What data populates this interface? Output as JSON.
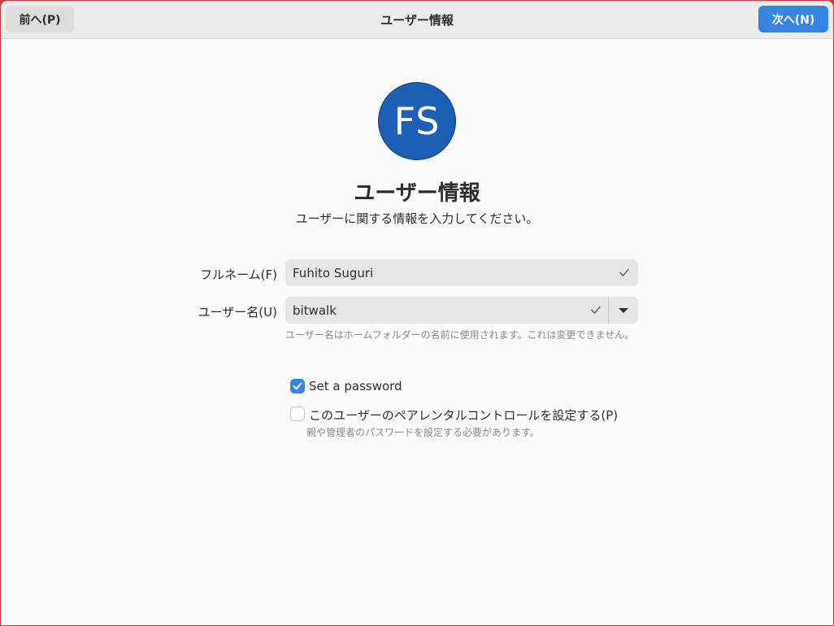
{
  "header": {
    "back_label": "前へ(P)",
    "title": "ユーザー情報",
    "next_label": "次へ(N)"
  },
  "avatar": {
    "initials": "FS",
    "color": "#1c5fb5"
  },
  "page": {
    "title": "ユーザー情報",
    "subtitle": "ユーザーに関する情報を入力してください。"
  },
  "form": {
    "fullname_label": "フルネーム(F)",
    "fullname_value": "Fuhito Suguri",
    "username_label": "ユーザー名(U)",
    "username_value": "bitwalk",
    "username_hint": "ユーザー名はホームフォルダーの名前に使用されます。これは変更できません。"
  },
  "options": {
    "set_password_label": "Set a password",
    "set_password_checked": true,
    "parental_label": "このユーザーのペアレンタルコントロールを設定する(P)",
    "parental_checked": false,
    "parental_hint": "親や管理者のパスワードを設定する必要があります。"
  },
  "colors": {
    "accent": "#3584e4",
    "window_bg": "#fafafa",
    "header_bg": "#ebebeb"
  },
  "icons": [
    "checkmark-icon",
    "chevron-down-icon"
  ]
}
